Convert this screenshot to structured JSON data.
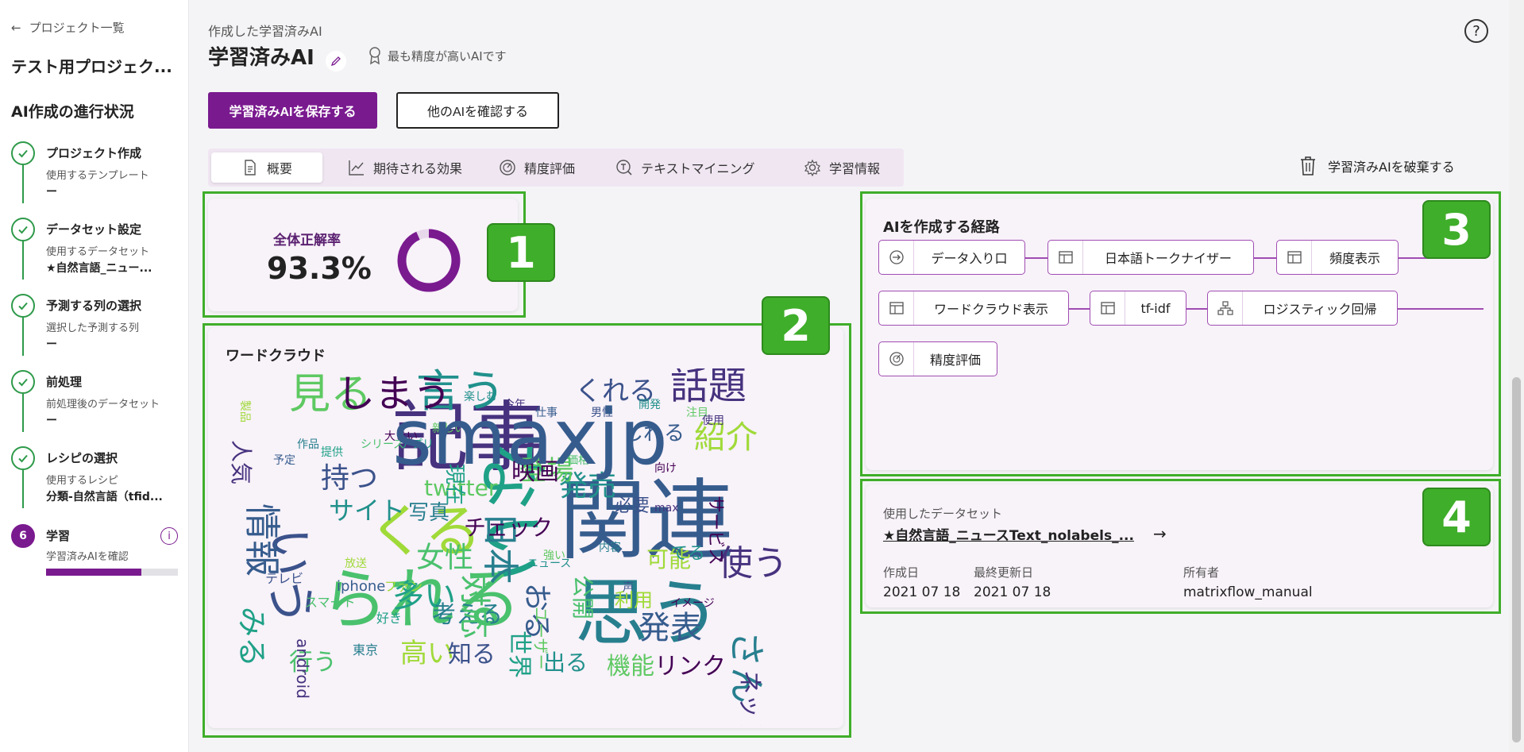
{
  "sidebar": {
    "back_label": "プロジェクト一覧",
    "project_name": "テスト用プロジェク...",
    "progress_title": "AI作成の進行状況",
    "steps": [
      {
        "title": "プロジェクト作成",
        "sub": "使用するテンプレート",
        "value": "ー"
      },
      {
        "title": "データセット設定",
        "sub": "使用するデータセット",
        "value": "★自然言語_ニュー..."
      },
      {
        "title": "予測する列の選択",
        "sub": "選択した予測する列",
        "value": "ー"
      },
      {
        "title": "前処理",
        "sub": "前処理後のデータセット",
        "value": "ー"
      },
      {
        "title": "レシピの選択",
        "sub": "使用するレシピ",
        "value": "分類-自然言語（tfid..."
      },
      {
        "number": "6",
        "title": "学習",
        "sub": "学習済みAIを確認",
        "progress": 0.72
      }
    ]
  },
  "header": {
    "crumb": "作成した学習済みAI",
    "title": "学習済みAI",
    "badge": "最も精度が高いAIです"
  },
  "buttons": {
    "save": "学習済みAIを保存する",
    "check_others": "他のAIを確認する",
    "discard": "学習済みAIを破棄する"
  },
  "tabs": [
    {
      "label": "概要",
      "icon": "document-icon"
    },
    {
      "label": "期待される効果",
      "icon": "line-chart-icon"
    },
    {
      "label": "精度評価",
      "icon": "gauge-icon"
    },
    {
      "label": "テキストマイニング",
      "icon": "text-search-icon"
    },
    {
      "label": "学習情報",
      "icon": "gear-icon"
    }
  ],
  "accuracy": {
    "label": "全体正解率",
    "value": "93.3%",
    "fraction": 0.933
  },
  "wordcloud": {
    "title": "ワードクラウド",
    "words": [
      "記事",
      "関連",
      "思う",
      "ない",
      "られる",
      "くる",
      "いう",
      "言う",
      "見る",
      "しまう",
      "話題",
      "情報",
      "日本",
      "多い",
      "女性",
      "紹介",
      "持つ",
      "発売",
      "登場",
      "映画",
      "使う",
      "発表",
      "さん",
      "みる",
      "行う",
      "高い",
      "知る",
      "出る",
      "機能",
      "リンク",
      "ネット",
      "おる",
      "考える",
      "世界",
      "対応",
      "可能",
      "くれる",
      "サイト",
      "twitter",
      "チェック",
      "人気",
      "しれる",
      "写真",
      "現在",
      "公開",
      "利用",
      "必要",
      "てる",
      "ユーザー",
      "サービス",
      "android",
      "iphone",
      "東京",
      "好き",
      "スマート",
      "ファン",
      "テレビ",
      "楽しむ",
      "新しい",
      "大きい",
      "今年",
      "仕事",
      "作品",
      "提供",
      "価格",
      "製品",
      "男性",
      "開発",
      "注目",
      "向け",
      "使用",
      "予定",
      "内容",
      "アプリ",
      "シリーズ",
      "放送",
      "声",
      "ニュース",
      "強い",
      "イメージ",
      "max",
      "smaxjp"
    ]
  },
  "pipeline": {
    "title": "AIを作成する経路",
    "nodes": [
      {
        "label": "データ入り口",
        "icon": "entry-icon"
      },
      {
        "label": "日本語トークナイザー",
        "icon": "dataframe-icon"
      },
      {
        "label": "頻度表示",
        "icon": "dataframe-icon"
      },
      {
        "label": "ワードクラウド表示",
        "icon": "dataframe-icon"
      },
      {
        "label": "tf-idf",
        "icon": "dataframe-icon"
      },
      {
        "label": "ロジスティック回帰",
        "icon": "model-tree-icon"
      },
      {
        "label": "精度評価",
        "icon": "gauge-icon"
      }
    ]
  },
  "dataset": {
    "label": "使用したデータセット",
    "name": "★自然言語_ニュースText_nolabels_...",
    "created_label": "作成日",
    "created": "2021 07 18",
    "updated_label": "最終更新日",
    "updated": "2021 07 18",
    "owner_label": "所有者",
    "owner": "matrixflow_manual"
  },
  "callouts": [
    "1",
    "2",
    "3",
    "4"
  ],
  "colors": {
    "accent": "#7a1a8f",
    "highlight": "#3fae2a",
    "success": "#2e9a4a"
  }
}
